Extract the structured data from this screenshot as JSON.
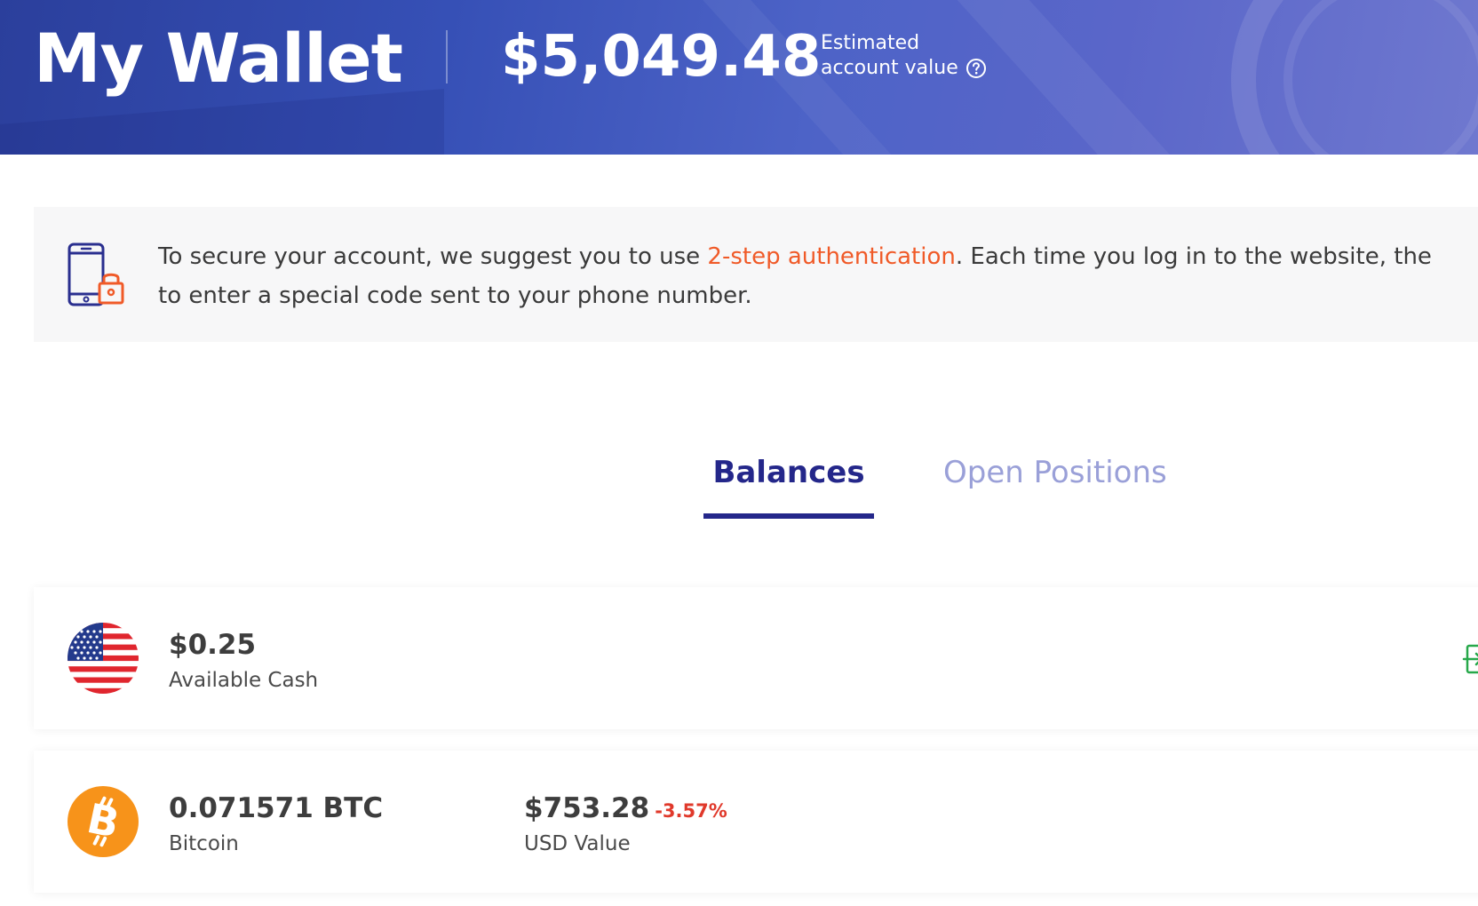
{
  "header": {
    "title": "My Wallet",
    "account_value": "$5,049.48",
    "account_value_label_line1": "Estimated",
    "account_value_label_line2": "account value",
    "help_icon": "question-circle-icon"
  },
  "notice": {
    "icon": "phone-lock-icon",
    "text_before": "To secure your account, we suggest you to use ",
    "link_text": "2-step authentication",
    "text_after": ". Each time you log in to the website, the",
    "text_line2": "to enter a special code sent to your phone number."
  },
  "tabs": [
    {
      "label": "Balances",
      "active": true
    },
    {
      "label": "Open Positions",
      "active": false
    }
  ],
  "balances": [
    {
      "icon": "us-flag-icon",
      "amount": "$0.25",
      "label": "Available Cash"
    },
    {
      "icon": "bitcoin-icon",
      "amount": "0.071571 BTC",
      "label": "Bitcoin",
      "usd_value": "$753.28",
      "change": "-3.57%",
      "usd_label": "USD Value"
    }
  ],
  "colors": {
    "accent": "#24278a",
    "link": "#f05a28",
    "negative": "#e0392b",
    "tab_inactive": "#9aa0d8",
    "bitcoin": "#f7931a"
  }
}
